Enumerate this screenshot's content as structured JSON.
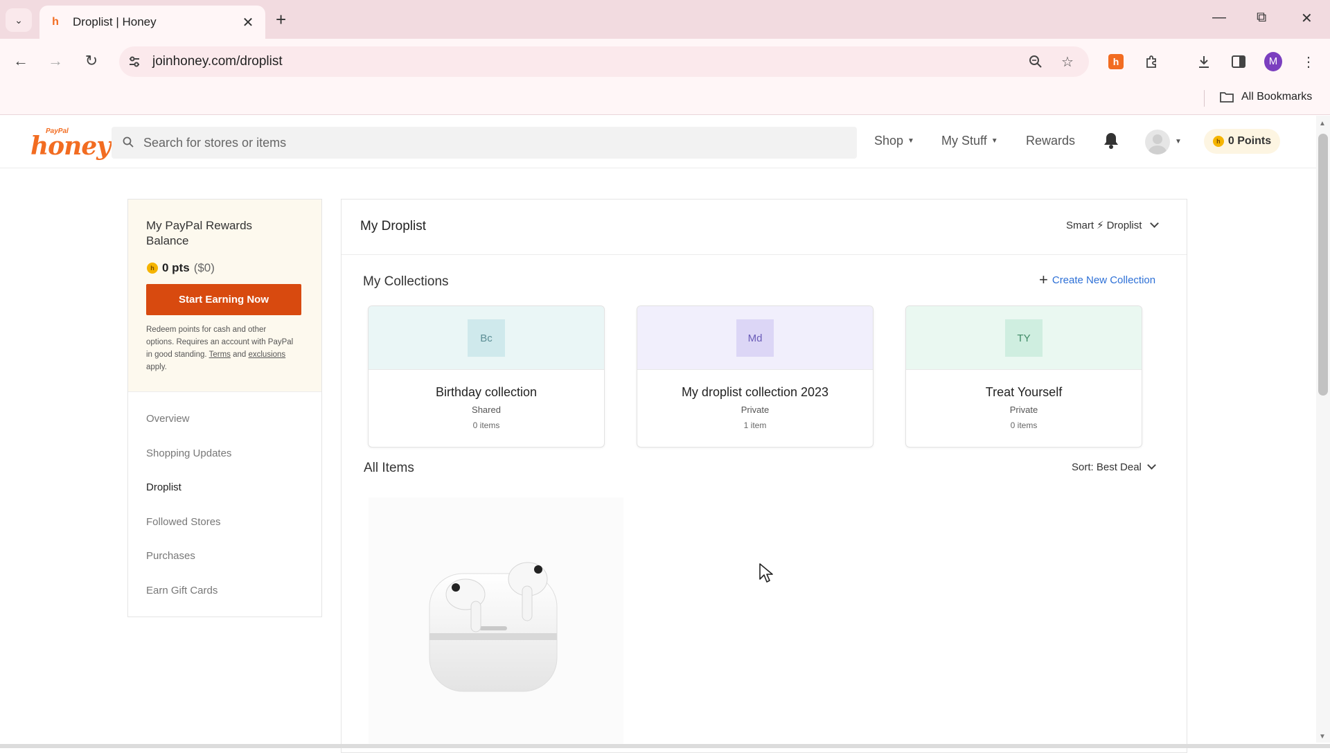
{
  "browser": {
    "tab_title": "Droplist | Honey",
    "url": "joinhoney.com/droplist",
    "bookmarks_label": "All Bookmarks",
    "profile_initial": "M"
  },
  "header": {
    "search_placeholder": "Search for stores or items",
    "nav": [
      {
        "label": "Shop"
      },
      {
        "label": "My Stuff"
      },
      {
        "label": "Rewards"
      }
    ],
    "points": "0 Points"
  },
  "sidebar": {
    "rewards_title": "My PayPal Rewards Balance",
    "points": "0 pts",
    "points_value": "($0)",
    "cta": "Start Earning Now",
    "note_1": "Redeem points for cash and other options. Requires an account with PayPal in good standing. ",
    "note_terms": "Terms",
    "note_and": " and ",
    "note_exclusions": "exclusions",
    "note_end": " apply.",
    "links": [
      {
        "label": "Overview"
      },
      {
        "label": "Shopping Updates"
      },
      {
        "label": "Droplist"
      },
      {
        "label": "Followed Stores"
      },
      {
        "label": "Purchases"
      },
      {
        "label": "Earn Gift Cards"
      }
    ]
  },
  "main": {
    "title": "My Droplist",
    "smart_label_1": "Smart",
    "smart_label_2": "Droplist",
    "collections_title": "My Collections",
    "create_label": "Create New Collection",
    "collections": [
      {
        "initials": "Bc",
        "name": "Birthday collection",
        "visibility": "Shared",
        "count": "0 items",
        "bg": "#eaf6f6",
        "badge_bg": "#cfe9ec",
        "badge_fg": "#5c8e95"
      },
      {
        "initials": "Md",
        "name": "My droplist collection 2023",
        "visibility": "Private",
        "count": "1 item",
        "bg": "#f1effc",
        "badge_bg": "#dcd6f6",
        "badge_fg": "#6a5cb8"
      },
      {
        "initials": "TY",
        "name": "Treat Yourself",
        "visibility": "Private",
        "count": "0 items",
        "bg": "#eaf8f1",
        "badge_bg": "#cfeee0",
        "badge_fg": "#3f8a66"
      }
    ],
    "all_items_title": "All Items",
    "sort_label": "Sort: Best Deal"
  }
}
